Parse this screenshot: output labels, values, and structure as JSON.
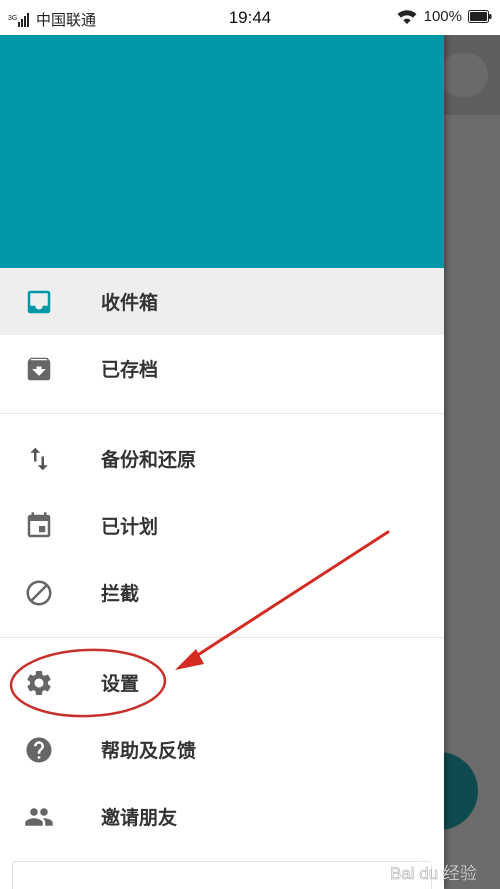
{
  "status_bar": {
    "carrier": "中国联通",
    "network_type": "3G",
    "time": "19:44",
    "battery": "100%"
  },
  "drawer": {
    "header_color": "#0097a7",
    "accent_color": "#0097a7",
    "groups": [
      [
        {
          "label": "收件箱",
          "icon": "inbox-icon",
          "active": true
        },
        {
          "label": "已存档",
          "icon": "archive-icon",
          "active": false
        }
      ],
      [
        {
          "label": "备份和还原",
          "icon": "swap-vertical-icon",
          "active": false
        },
        {
          "label": "已计划",
          "icon": "calendar-icon",
          "active": false
        },
        {
          "label": "拦截",
          "icon": "block-icon",
          "active": false
        }
      ],
      [
        {
          "label": "设置",
          "icon": "gear-icon",
          "active": false
        },
        {
          "label": "帮助及反馈",
          "icon": "help-icon",
          "active": false
        },
        {
          "label": "邀请朋友",
          "icon": "people-icon",
          "active": false
        }
      ]
    ]
  },
  "annotation": {
    "circle_color": "#c8302c",
    "arrow_color": "#d42a22",
    "target": "设置"
  },
  "watermark": {
    "text": "Bai du 经验"
  }
}
